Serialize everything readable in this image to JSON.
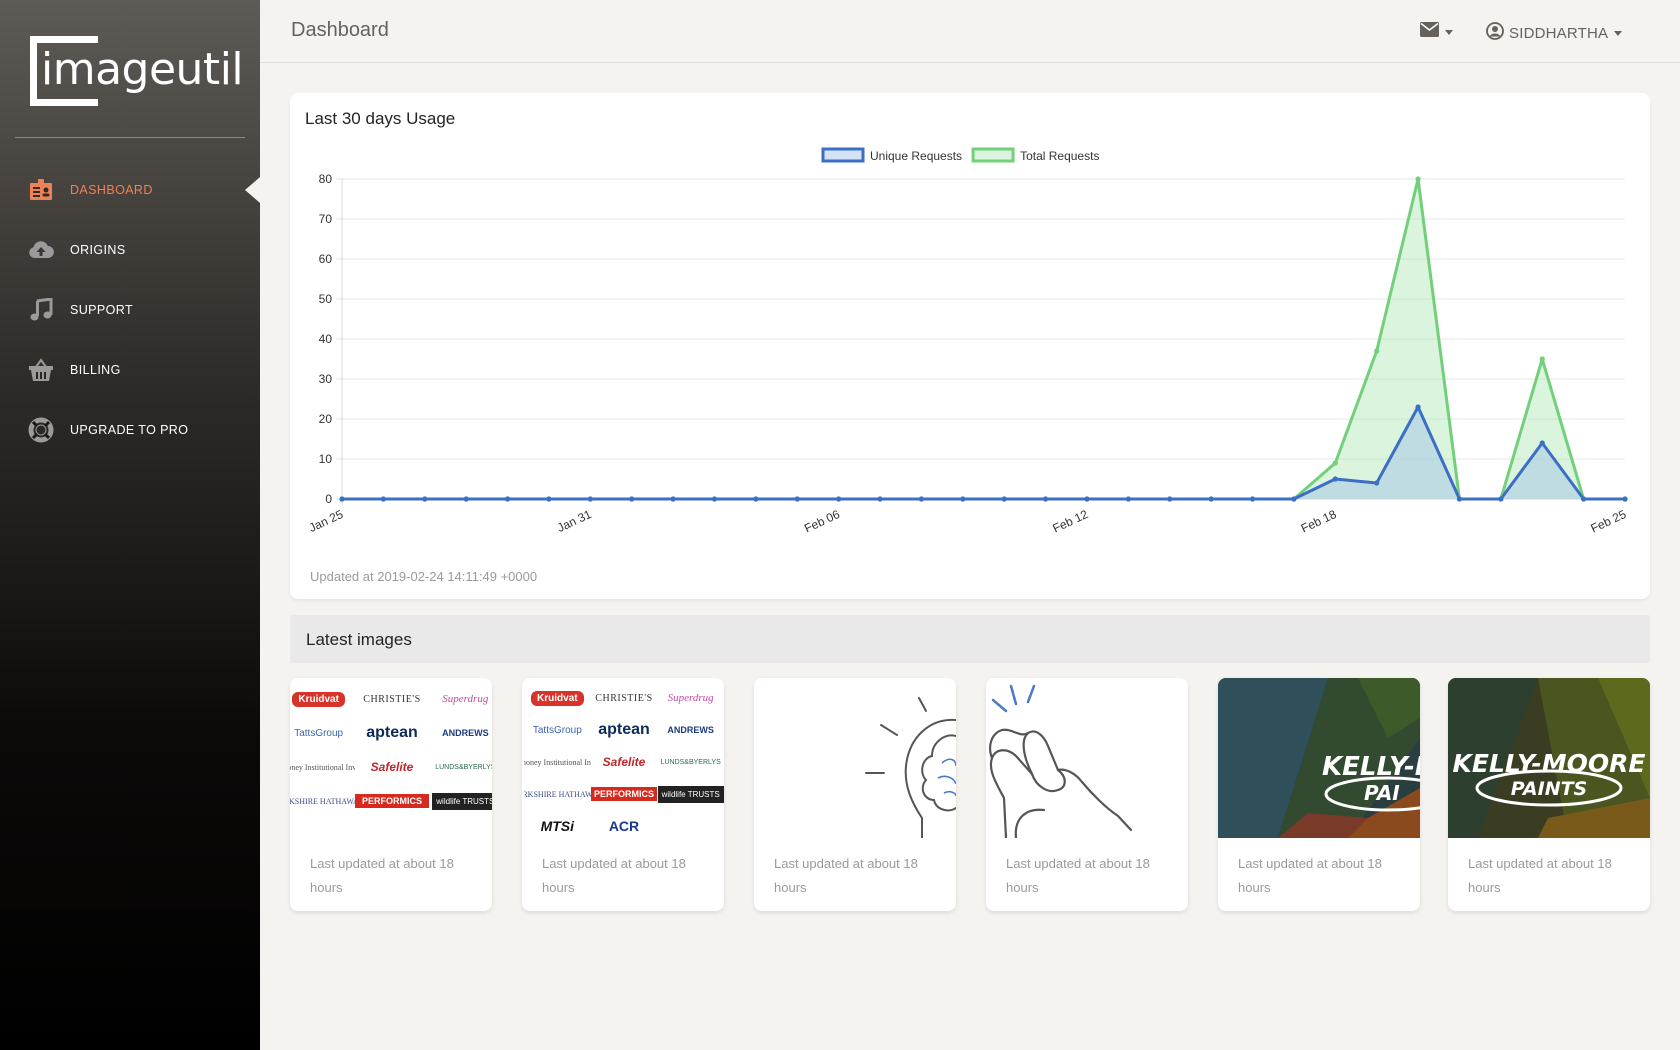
{
  "app": {
    "logo_text": "imageutil"
  },
  "sidebar": {
    "items": [
      {
        "label": "DASHBOARD",
        "icon": "id-badge-icon",
        "active": true
      },
      {
        "label": "ORIGINS",
        "icon": "cloud-upload-icon",
        "active": false
      },
      {
        "label": "SUPPORT",
        "icon": "music-note-icon",
        "active": false
      },
      {
        "label": "BILLING",
        "icon": "basket-icon",
        "active": false
      },
      {
        "label": "UPGRADE TO PRO",
        "icon": "lifebuoy-icon",
        "active": false
      }
    ]
  },
  "header": {
    "title": "Dashboard",
    "mail_icon": "envelope-icon",
    "user_icon": "user-circle-icon",
    "username": "SIDDHARTHA"
  },
  "usage": {
    "title": "Last 30 days Usage",
    "updated": "Updated at 2019-02-24 14:11:49 +0000"
  },
  "chart_data": {
    "type": "area",
    "x": [
      "Jan 25",
      "Jan 26",
      "Jan 27",
      "Jan 28",
      "Jan 29",
      "Jan 30",
      "Jan 31",
      "Feb 01",
      "Feb 02",
      "Feb 03",
      "Feb 04",
      "Feb 05",
      "Feb 06",
      "Feb 07",
      "Feb 08",
      "Feb 09",
      "Feb 10",
      "Feb 11",
      "Feb 12",
      "Feb 13",
      "Feb 14",
      "Feb 15",
      "Feb 16",
      "Feb 17",
      "Feb 18",
      "Feb 19",
      "Feb 20",
      "Feb 21",
      "Feb 22",
      "Feb 23",
      "Feb 24",
      "Feb 25"
    ],
    "xticks": [
      "Jan 25",
      "Jan 31",
      "Feb 06",
      "Feb 12",
      "Feb 18",
      "Feb 25"
    ],
    "series": [
      {
        "name": "Unique Requests",
        "color": "#3b6fc6",
        "fill": "rgba(160,190,235,0.45)",
        "values": [
          0,
          0,
          0,
          0,
          0,
          0,
          0,
          0,
          0,
          0,
          0,
          0,
          0,
          0,
          0,
          0,
          0,
          0,
          0,
          0,
          0,
          0,
          0,
          0,
          5,
          4,
          23,
          0,
          0,
          14,
          0,
          0
        ]
      },
      {
        "name": "Total Requests",
        "color": "#72d07a",
        "fill": "rgba(175,230,180,0.45)",
        "values": [
          0,
          0,
          0,
          0,
          0,
          0,
          0,
          0,
          0,
          0,
          0,
          0,
          0,
          0,
          0,
          0,
          0,
          0,
          0,
          0,
          0,
          0,
          0,
          0,
          9,
          37,
          80,
          0,
          0,
          35,
          0,
          0
        ]
      }
    ],
    "ylim": [
      0,
      80
    ],
    "yticks": [
      0,
      10,
      20,
      30,
      40,
      50,
      60,
      70,
      80
    ],
    "grid": true,
    "legend": "top-center"
  },
  "latest": {
    "title": "Latest images",
    "cards": [
      {
        "kind": "logos",
        "caption": "Last updated at about 18 hours"
      },
      {
        "kind": "logos2",
        "caption": "Last updated at about 18 hours"
      },
      {
        "kind": "idea",
        "caption": "Last updated at about 18 hours"
      },
      {
        "kind": "snap",
        "caption": "Last updated at about 18 hours"
      },
      {
        "kind": "kelly-crop",
        "caption": "Last updated at about 18 hours"
      },
      {
        "kind": "kelly",
        "caption": "Last updated at about 18 hours"
      }
    ],
    "logos": {
      "kruidvat": "Kruidvat",
      "christies": "CHRISTIE'S",
      "superdrug": "Superdrug",
      "tatts": "TattsGroup",
      "aptean": "aptean",
      "andrews": "ANDREWS",
      "euromoney": "Euromoney Institutional Investor",
      "safelite": "Safelite",
      "lunds": "LUNDS&BYERLYS",
      "berkshire": "BERKSHIRE HATHAWAY",
      "performics": "PERFORMICS",
      "wildlife": "wildlife TRUSTS",
      "mtsi": "MTSi",
      "acr": "ACR"
    },
    "kelly": {
      "line1": "KELLY-MOORE",
      "line2": "PAINTS",
      "crop1": "KELLY-M",
      "crop2": "PAI"
    }
  }
}
